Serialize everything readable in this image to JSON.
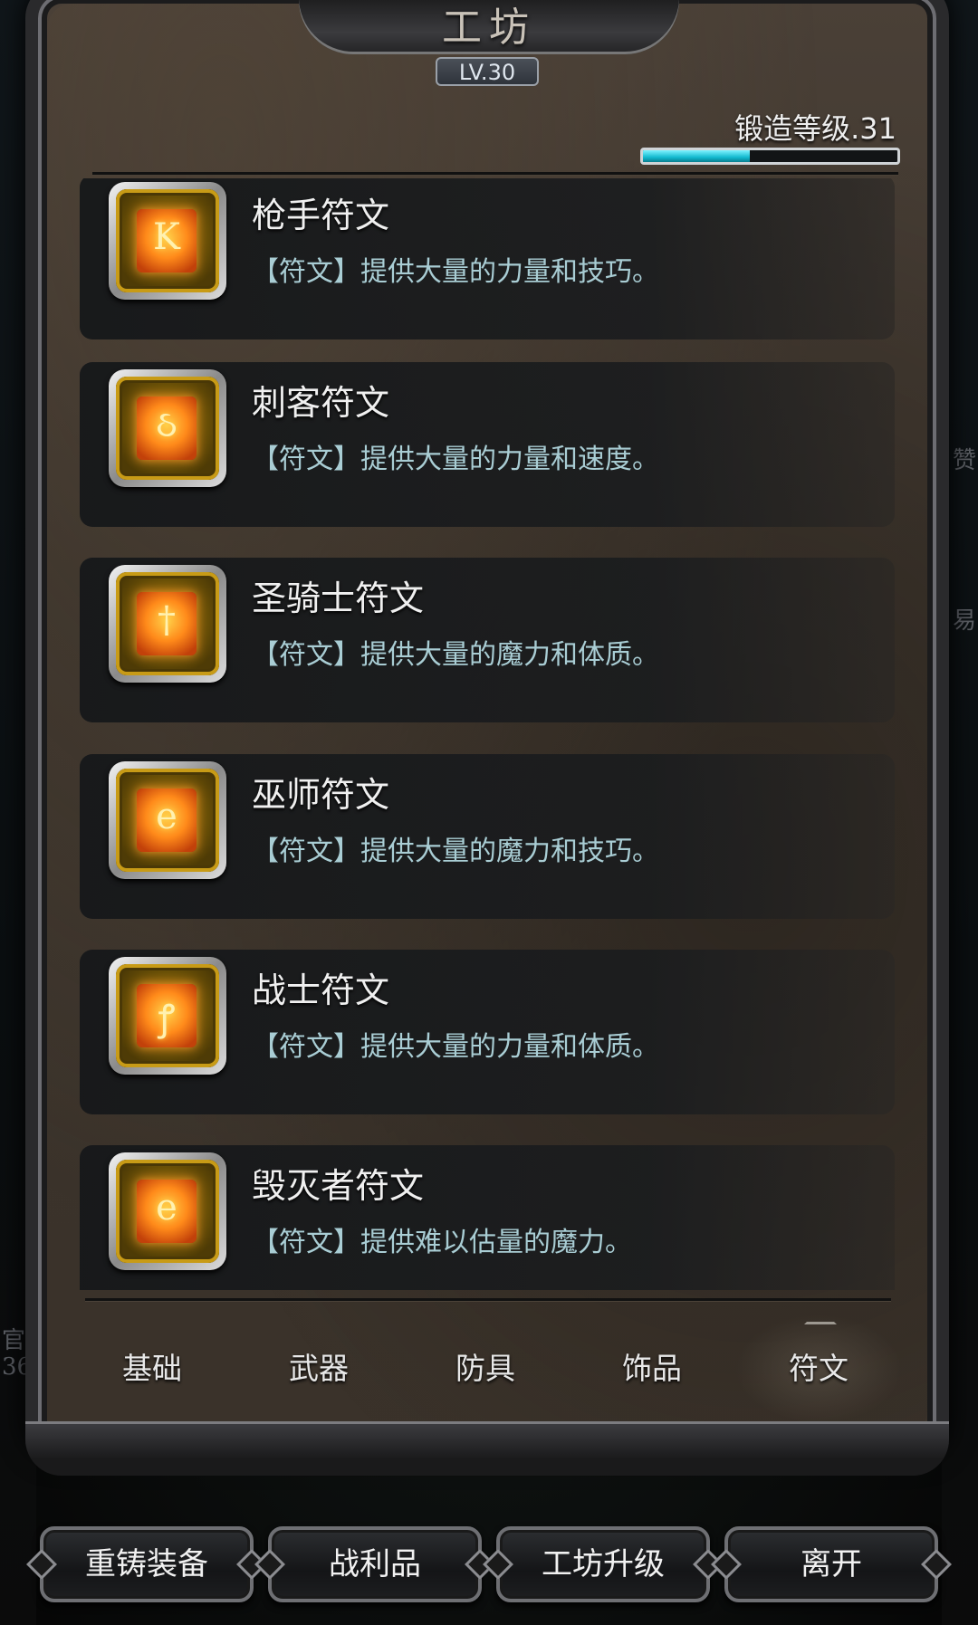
{
  "header": {
    "title": "工坊",
    "level_badge": "LV.30"
  },
  "forge": {
    "label": "锻造等级.31",
    "progress": 0.42
  },
  "background": {
    "left_text_1": "官",
    "left_text_2": "36",
    "right_text_1": "赞",
    "right_text_2": "易"
  },
  "runes": [
    {
      "name": "枪手符文",
      "desc": "【符文】提供大量的力量和技巧。",
      "glyph": "K"
    },
    {
      "name": "刺客符文",
      "desc": "【符文】提供大量的力量和速度。",
      "glyph": "ઠ"
    },
    {
      "name": "圣骑士符文",
      "desc": "【符文】提供大量的魔力和体质。",
      "glyph": "†"
    },
    {
      "name": "巫师符文",
      "desc": "【符文】提供大量的魔力和技巧。",
      "glyph": "e"
    },
    {
      "name": "战士符文",
      "desc": "【符文】提供大量的力量和体质。",
      "glyph": "ꝭ"
    },
    {
      "name": "毁灭者符文",
      "desc": "【符文】提供难以估量的魔力。",
      "glyph": "e"
    }
  ],
  "tabs": {
    "basic": "基础",
    "weapons": "武器",
    "armor": "防具",
    "accessories": "饰品",
    "runes": "符文",
    "active": "runes"
  },
  "buttons": {
    "reforge": "重铸装备",
    "loot": "战利品",
    "upgrade": "工坊升级",
    "leave": "离开"
  },
  "colors": {
    "progress_fill": "#12b9cf",
    "description_text": "#a9cdd4"
  }
}
